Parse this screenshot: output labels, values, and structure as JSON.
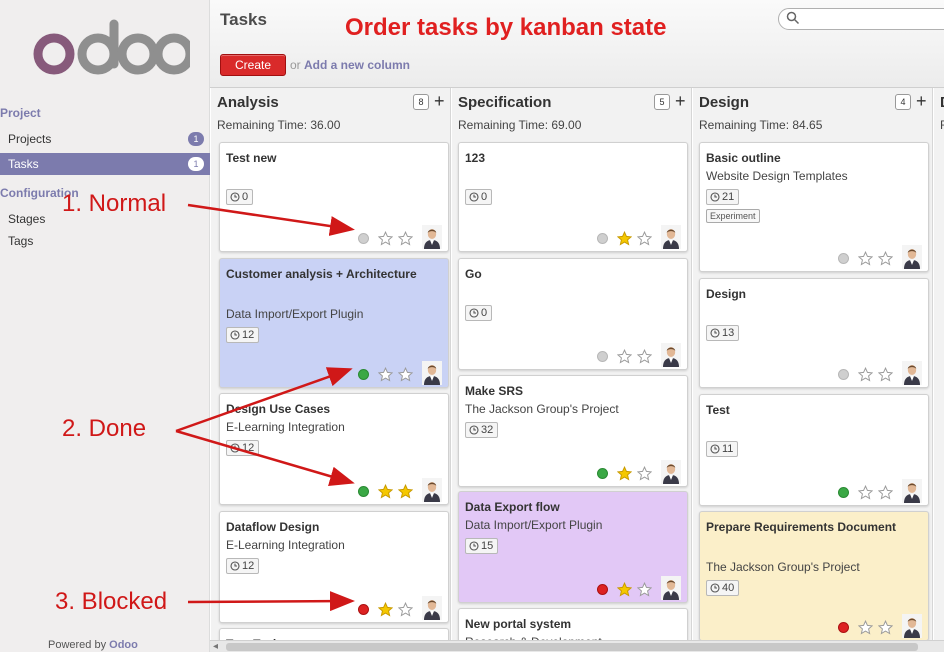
{
  "sidebar": {
    "logo_text": "odoo",
    "sections": [
      {
        "label": "Project",
        "items": [
          {
            "label": "Projects",
            "badge": "1",
            "active": false
          },
          {
            "label": "Tasks",
            "badge": "1",
            "active": true
          }
        ]
      },
      {
        "label": "Configuration",
        "items": [
          {
            "label": "Stages",
            "active": false
          },
          {
            "label": "Tags",
            "active": false
          }
        ]
      }
    ],
    "powered_prefix": "Powered by",
    "powered_brand": "Odoo"
  },
  "header": {
    "title": "Tasks",
    "banner": "Order tasks by kanban state",
    "search_value": "",
    "create_label": "Create",
    "or_text": "or",
    "add_column_label": "Add a new column"
  },
  "columns": [
    {
      "title": "Analysis",
      "count": "8",
      "remaining": "Remaining Time: 36.00",
      "cards": [
        {
          "title": "Test new",
          "hours": "0",
          "state": "normal",
          "stars": 0,
          "color": "#ffffff"
        },
        {
          "title": "Customer analysis + Architecture",
          "subtitle": "Data Import/Export Plugin",
          "hours": "12",
          "state": "done",
          "stars": 0,
          "color": "#c9d2f5"
        },
        {
          "title": "Design Use Cases",
          "subtitle": "E-Learning Integration",
          "hours": "12",
          "state": "done",
          "stars": 2,
          "color": "#ffffff"
        },
        {
          "title": "Dataflow Design",
          "subtitle": "E-Learning Integration",
          "hours": "12",
          "state": "blocked",
          "stars": 1,
          "color": "#ffffff"
        },
        {
          "title": "Test Task",
          "color": "#ffffff"
        }
      ]
    },
    {
      "title": "Specification",
      "count": "5",
      "remaining": "Remaining Time: 69.00",
      "cards": [
        {
          "title": "123",
          "hours": "0",
          "state": "normal",
          "stars": 1,
          "color": "#ffffff"
        },
        {
          "title": "Go",
          "hours": "0",
          "state": "normal",
          "stars": 0,
          "color": "#ffffff"
        },
        {
          "title": "Make SRS",
          "subtitle": "The Jackson Group's Project",
          "hours": "32",
          "state": "done",
          "stars": 1,
          "color": "#ffffff"
        },
        {
          "title": "Data Export flow",
          "subtitle": "Data Import/Export Plugin",
          "hours": "15",
          "state": "blocked",
          "stars": 1,
          "color": "#e2c8f6"
        },
        {
          "title": "New portal system",
          "subtitle": "Research & Development",
          "color": "#ffffff"
        }
      ]
    },
    {
      "title": "Design",
      "count": "4",
      "remaining": "Remaining Time: 84.65",
      "cards": [
        {
          "title": "Basic outline",
          "subtitle": "Website Design Templates",
          "hours": "21",
          "tag": "Experiment",
          "state": "normal",
          "stars": 0,
          "color": "#ffffff"
        },
        {
          "title": "Design",
          "hours": "13",
          "state": "normal",
          "stars": 0,
          "color": "#ffffff"
        },
        {
          "title": "Test",
          "hours": "11",
          "state": "done",
          "stars": 0,
          "color": "#ffffff"
        },
        {
          "title": "Prepare Requirements Document",
          "subtitle": "The Jackson Group's Project",
          "hours": "40",
          "state": "blocked",
          "stars": 0,
          "color": "#fbefc9"
        }
      ]
    },
    {
      "title": "D",
      "remaining": "R",
      "cards": []
    }
  ],
  "annotations": {
    "normal": "1. Normal",
    "done": "2. Done",
    "blocked": "3. Blocked"
  },
  "colors": {
    "brand": "#7c7bad",
    "create": "#d92a2a",
    "annotation": "#d01818",
    "state_normal": "#cfcfcf",
    "state_done": "#3aa845",
    "state_blocked": "#dd2222",
    "star_on": "#f5c800",
    "star_off": "#ffffff"
  }
}
